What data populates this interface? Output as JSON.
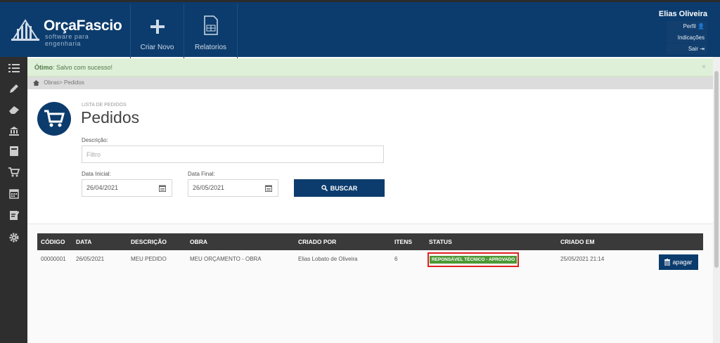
{
  "header": {
    "brand": "OrçaFascio",
    "tagline": "software para engenharia",
    "nav": [
      {
        "label": "Criar Novo",
        "icon": "plus-icon"
      },
      {
        "label": "Relatorios",
        "icon": "report-icon"
      }
    ],
    "user": {
      "name": "Elias Oliveira",
      "links": [
        "Perfil",
        "Indicações",
        "Sair"
      ]
    }
  },
  "sidebar": {
    "icons": [
      "list-icon",
      "pencil-icon",
      "eraser-icon",
      "bank-icon",
      "book-icon",
      "cart-icon",
      "calendar-icon",
      "clipboard-icon",
      "gear-icon"
    ]
  },
  "alert": {
    "strong": "Ótimo",
    "message": ": Salvo com sucesso!",
    "close": "×"
  },
  "breadcrumb": {
    "items": [
      "Obras",
      "Pedidos"
    ]
  },
  "page": {
    "subtitle": "LISTA DE PEDIDOS",
    "title": "Pedidos"
  },
  "filters": {
    "description_label": "Descrição:",
    "description_placeholder": "Filtro",
    "start_label": "Data Inicial:",
    "start_value": "26/04/2021",
    "end_label": "Data Final:",
    "end_value": "26/05/2021",
    "search_button": "BUSCAR"
  },
  "table": {
    "columns": [
      "CÓDIGO",
      "DATA",
      "DESCRIÇÃO",
      "OBRA",
      "CRIADO POR",
      "ITENS",
      "STATUS",
      "CRIADO EM"
    ],
    "rows": [
      {
        "codigo": "00000001",
        "data": "26/05/2021",
        "descricao": "MEU PEDIDO",
        "obra": "MEU ORÇAMENTO - OBRA",
        "criado_por": "Elias Lobato de Oliveira",
        "itens": "6",
        "status": "REPONSÁVEL TÉCNICO - APROVADO",
        "criado_em": "25/05/2021 21:14",
        "action": "apagar"
      }
    ]
  },
  "colors": {
    "primary": "#0c3c6d",
    "sidebar": "#2e2e2e",
    "success_bg": "#dff0d8",
    "status_badge": "#4c9a35",
    "highlight": "#e02020"
  }
}
